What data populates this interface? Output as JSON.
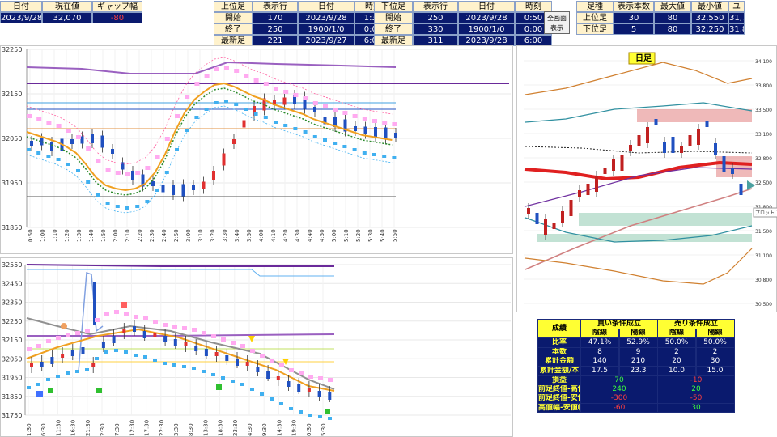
{
  "header": {
    "current": {
      "labels": [
        "日付",
        "現在値",
        "ギャップ幅"
      ],
      "values": [
        "2023/9/28",
        "32,070",
        "-80"
      ]
    },
    "upper": {
      "labels": [
        "上位足",
        "表示行",
        "日付",
        "時刻"
      ],
      "rows": [
        [
          "開始",
          "170",
          "2023/9/28",
          "1:30"
        ],
        [
          "終了",
          "250",
          "1900/1/0",
          "0:00"
        ],
        [
          "最新足",
          "221",
          "2023/9/27",
          "6:00"
        ]
      ]
    },
    "lower": {
      "labels": [
        "下位足",
        "表示行",
        "日付",
        "時刻"
      ],
      "rows": [
        [
          "開始",
          "250",
          "2023/9/28",
          "0:50"
        ],
        [
          "終了",
          "330",
          "1900/1/0",
          "0:00"
        ],
        [
          "最新足",
          "311",
          "2023/9/28",
          "6:00"
        ]
      ]
    },
    "fullscreen_button": "全画面\n表示",
    "range": {
      "labels": [
        "足種",
        "表示本数",
        "最大値",
        "最小値",
        "ユ"
      ],
      "rows": [
        [
          "上位足",
          "30",
          "80",
          "32,550",
          "31,750"
        ],
        [
          "下位足",
          "5",
          "80",
          "32,250",
          "31,850"
        ]
      ]
    }
  },
  "top_chart": {
    "y_ticks": [
      "32250",
      "32150",
      "32050",
      "31950",
      "31850"
    ],
    "x_ticks": [
      "0:50",
      "1:00",
      "1:10",
      "1:20",
      "1:30",
      "1:40",
      "1:50",
      "2:00",
      "2:10",
      "2:20",
      "2:30",
      "2:40",
      "2:50",
      "3:00",
      "3:10",
      "3:20",
      "3:30",
      "3:40",
      "3:50",
      "4:00",
      "4:10",
      "4:20",
      "4:30",
      "4:40",
      "4:50",
      "5:00",
      "5:10",
      "5:20",
      "5:30",
      "5:40",
      "5:50"
    ]
  },
  "bottom_chart": {
    "y_ticks": [
      "32550",
      "32450",
      "32350",
      "32250",
      "32150",
      "32050",
      "31950",
      "31850",
      "31750"
    ],
    "x_ticks": [
      "1:30",
      "6:30",
      "11:30",
      "16:30",
      "21:30",
      "2:30",
      "7:30",
      "12:30",
      "17:30",
      "22:30",
      "3:30",
      "8:30",
      "13:30",
      "18:30",
      "23:30",
      "4:30",
      "9:30",
      "14:30",
      "19:30",
      "0:30",
      "5:30"
    ]
  },
  "daily_chart": {
    "title": "日足",
    "y_ticks": [
      "34,100",
      "33,800",
      "33,500",
      "33,100",
      "32,800",
      "32,500",
      "31,800",
      "31,500",
      "31,100",
      "30,800",
      "30,500"
    ],
    "tooltip": "プロット エリ"
  },
  "results": {
    "title": "成績",
    "buy_header": "買い条件成立",
    "sell_header": "売り条件成立",
    "sub_headers": [
      "陰線",
      "陽線",
      "陰線",
      "陽線"
    ],
    "rows": [
      {
        "label": "比率",
        "values": [
          "47.1%",
          "52.9%",
          "50.0%",
          "50.0%"
        ]
      },
      {
        "label": "本数",
        "values": [
          "8",
          "9",
          "2",
          "2"
        ]
      },
      {
        "label": "累計金額",
        "values": [
          "140",
          "210",
          "20",
          "30"
        ]
      },
      {
        "label": "累計金額/本",
        "values": [
          "17.5",
          "23.3",
          "10.0",
          "15.0"
        ]
      }
    ],
    "summary": [
      {
        "label": "損益",
        "buy": "70",
        "sell": "-10"
      },
      {
        "label": "前足終値-高値幅",
        "buy": "240",
        "sell": "20"
      },
      {
        "label": "前足終値-安値幅",
        "buy": "-300",
        "sell": "-50"
      },
      {
        "label": "高値幅-安値幅",
        "buy": "-60",
        "sell": "30"
      }
    ]
  },
  "colors": {
    "header_value_bg": "#0a1a6e",
    "header_label_bg": "#fff2cc",
    "bull_candle": "#e03030",
    "bear_candle": "#2050c0",
    "upper_band": "#ffaaf0",
    "lower_band": "#40b0f0",
    "results_highlight": "#ffff33"
  }
}
